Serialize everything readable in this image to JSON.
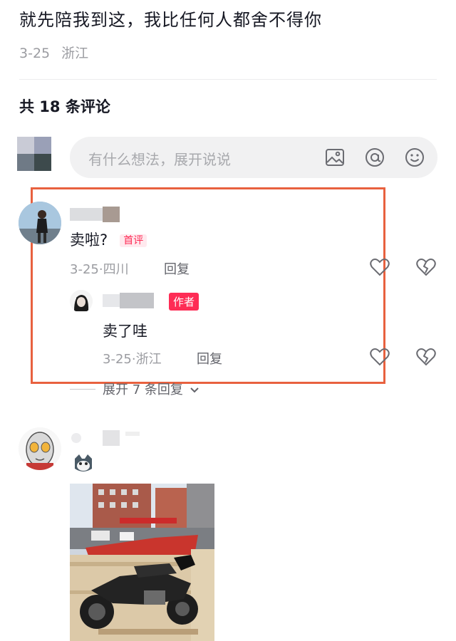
{
  "post": {
    "text": "就先陪我到这，我比任何人都舍不得你",
    "date": "3-25",
    "location": "浙江"
  },
  "comments_header": "共 18 条评论",
  "comment_input": {
    "placeholder": "有什么想法，展开说说",
    "icons": [
      "image-icon",
      "mention-icon",
      "emoji-icon"
    ]
  },
  "comments": [
    {
      "text": "卖啦?",
      "badge": "首评",
      "date": "3-25·",
      "location": "四川",
      "reply_label": "回复",
      "replies": [
        {
          "badge": "作者",
          "text": "卖了哇",
          "date": "3-25·",
          "location": "浙江",
          "reply_label": "回复"
        }
      ],
      "expand_label": "展开 7 条回复"
    }
  ],
  "colors": {
    "accent": "#fe2c55",
    "highlight_border": "#e8613f",
    "secondary_text": "#9b9ca1"
  }
}
